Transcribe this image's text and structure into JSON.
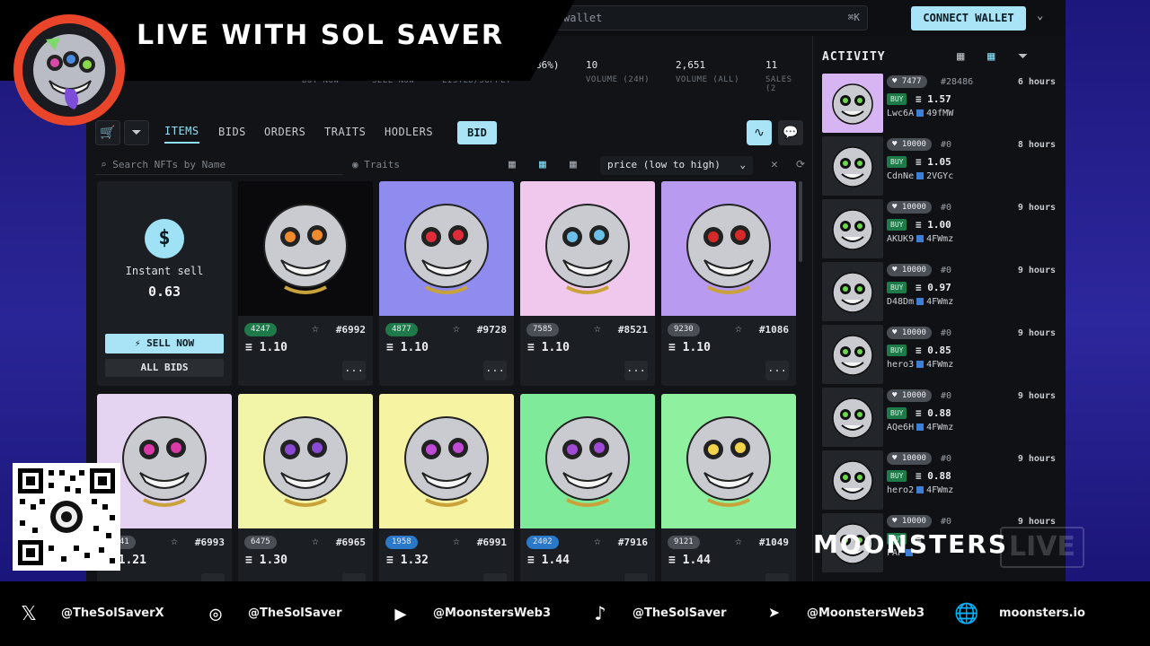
{
  "stream": {
    "title": "LIVE WITH SOL SAVER",
    "brand_logo_text": "MOONSTERS",
    "live_watermark": "LIVE"
  },
  "topbar": {
    "search_text": "wallet",
    "search_shortcut": "⌘K",
    "connect_label": "CONNECT WALLET"
  },
  "stats": [
    {
      "value": "86%)",
      "label": "LISTED/SUPPLY"
    },
    {
      "value": "10",
      "label": "VOLUME (24H)"
    },
    {
      "value": "2,651",
      "label": "VOLUME (ALL)"
    },
    {
      "value": "11",
      "label": "SALES (2"
    }
  ],
  "stat_left_labels": [
    "BUY NOW",
    "SELL NOW"
  ],
  "tabs": [
    "ITEMS",
    "BIDS",
    "ORDERS",
    "TRAITS",
    "HODLERS"
  ],
  "bid_label": "BID",
  "filters": {
    "search_placeholder": "Search NFTs by Name",
    "traits_label": "Traits",
    "sort_value": "price (low to high)"
  },
  "instant_sell": {
    "icon": "$",
    "label": "Instant sell",
    "value": "0.63",
    "sell_now_label": "⚡ SELL NOW",
    "all_bids_label": "ALL BIDS"
  },
  "cards": [
    {
      "likes": "4247",
      "likes_color": "green",
      "id": "#6992",
      "price": "1.10",
      "bg": "#0a0a0c"
    },
    {
      "likes": "4877",
      "likes_color": "green",
      "id": "#9728",
      "price": "1.10",
      "bg": "#8f8bef"
    },
    {
      "likes": "7585",
      "likes_color": "gray",
      "id": "#8521",
      "price": "1.10",
      "bg": "#f0c8ee"
    },
    {
      "likes": "9230",
      "likes_color": "gray",
      "id": "#1086",
      "price": "1.10",
      "bg": "#b89af0"
    },
    {
      "likes": "7041",
      "likes_color": "gray",
      "id": "#6993",
      "price": "1.21",
      "bg": "#e5d3f2"
    },
    {
      "likes": "6475",
      "likes_color": "gray",
      "id": "#6965",
      "price": "1.30",
      "bg": "#f2f5a8"
    },
    {
      "likes": "1958",
      "likes_color": "blue",
      "id": "#6991",
      "price": "1.32",
      "bg": "#f6f3a2"
    },
    {
      "likes": "2402",
      "likes_color": "blue",
      "id": "#7916",
      "price": "1.44",
      "bg": "#7fea9a"
    },
    {
      "likes": "9121",
      "likes_color": "gray",
      "id": "#1049",
      "price": "1.44",
      "bg": "#8ff0a0"
    }
  ],
  "more_label": "...",
  "activity": {
    "title": "ACTIVITY",
    "rows": [
      {
        "likes": "7477",
        "id": "#28486",
        "time": "6 hours",
        "action": "BUY",
        "price": "1.57",
        "from": "Lwc6A",
        "to": "49fMW"
      },
      {
        "likes": "10000",
        "id": "#0",
        "time": "8 hours",
        "action": "BUY",
        "price": "1.05",
        "from": "CdnNe",
        "to": "2VGYc"
      },
      {
        "likes": "10000",
        "id": "#0",
        "time": "9 hours",
        "action": "BUY",
        "price": "1.00",
        "from": "AKUK9",
        "to": "4FWmz"
      },
      {
        "likes": "10000",
        "id": "#0",
        "time": "9 hours",
        "action": "BUY",
        "price": "0.97",
        "from": "D48Dm",
        "to": "4FWmz"
      },
      {
        "likes": "10000",
        "id": "#0",
        "time": "9 hours",
        "action": "BUY",
        "price": "0.85",
        "from": "hero3",
        "to": "4FWmz"
      },
      {
        "likes": "10000",
        "id": "#0",
        "time": "9 hours",
        "action": "BUY",
        "price": "0.88",
        "from": "AQe6H",
        "to": "4FWmz"
      },
      {
        "likes": "10000",
        "id": "#0",
        "time": "9 hours",
        "action": "BUY",
        "price": "0.88",
        "from": "hero2",
        "to": "4FWmz"
      },
      {
        "likes": "10000",
        "id": "#0",
        "time": "9 hours",
        "action": "BUY",
        "price": "",
        "from": "FAP",
        "to": ""
      }
    ]
  },
  "footer": [
    {
      "icon": "x-icon",
      "handle": "@TheSolSaverX"
    },
    {
      "icon": "instagram-icon",
      "handle": "@TheSolSaver"
    },
    {
      "icon": "youtube-icon",
      "handle": "@MoonstersWeb3"
    },
    {
      "icon": "tiktok-icon",
      "handle": "@TheSolSaver"
    },
    {
      "icon": "telegram-icon",
      "handle": "@MoonstersWeb3"
    },
    {
      "icon": "globe-icon",
      "handle": "moonsters.io"
    }
  ]
}
